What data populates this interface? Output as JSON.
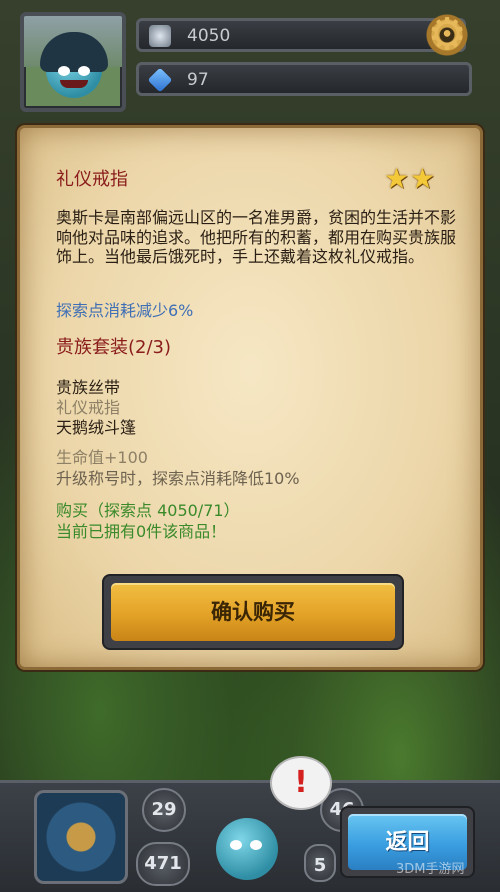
{
  "hud": {
    "gold": "4050",
    "gems": "97",
    "avatar_icon": "monster-avatar",
    "settings_icon": "gear-icon"
  },
  "item": {
    "name": "礼仪戒指",
    "stars": 2,
    "description": "奥斯卡是南部偏远山区的一名准男爵，贫困的生活并不影响他对品味的追求。他把所有的积蓄，都用在购买贵族服饰上。当他最后饿死时，手上还戴着这枚礼仪戒指。",
    "effect": "探索点消耗减少6%",
    "set_name": "贵族套装(2/3)",
    "set_pieces": [
      "贵族丝带",
      "礼仪戒指",
      "天鹅绒斗篷"
    ],
    "set_bonus": [
      "生命值+100",
      "升级称号时，探索点消耗降低10%"
    ],
    "price_line": "购买（探索点 4050/71）",
    "owned_line": "当前已拥有0件该商品！"
  },
  "buttons": {
    "confirm": "确认购买",
    "back": "返回"
  },
  "bottom_hud": {
    "counter_a": "29",
    "counter_b": "471",
    "counter_c": "46",
    "counter_d": "5",
    "alert_mark": "!"
  },
  "watermark": "3DM手游网",
  "colors": {
    "title_red": "#8a1c1c",
    "effect_blue": "#3f6fb5",
    "buy_green": "#3a8a2a",
    "confirm_gold": "#e3a227",
    "back_blue": "#3a9ee0"
  }
}
